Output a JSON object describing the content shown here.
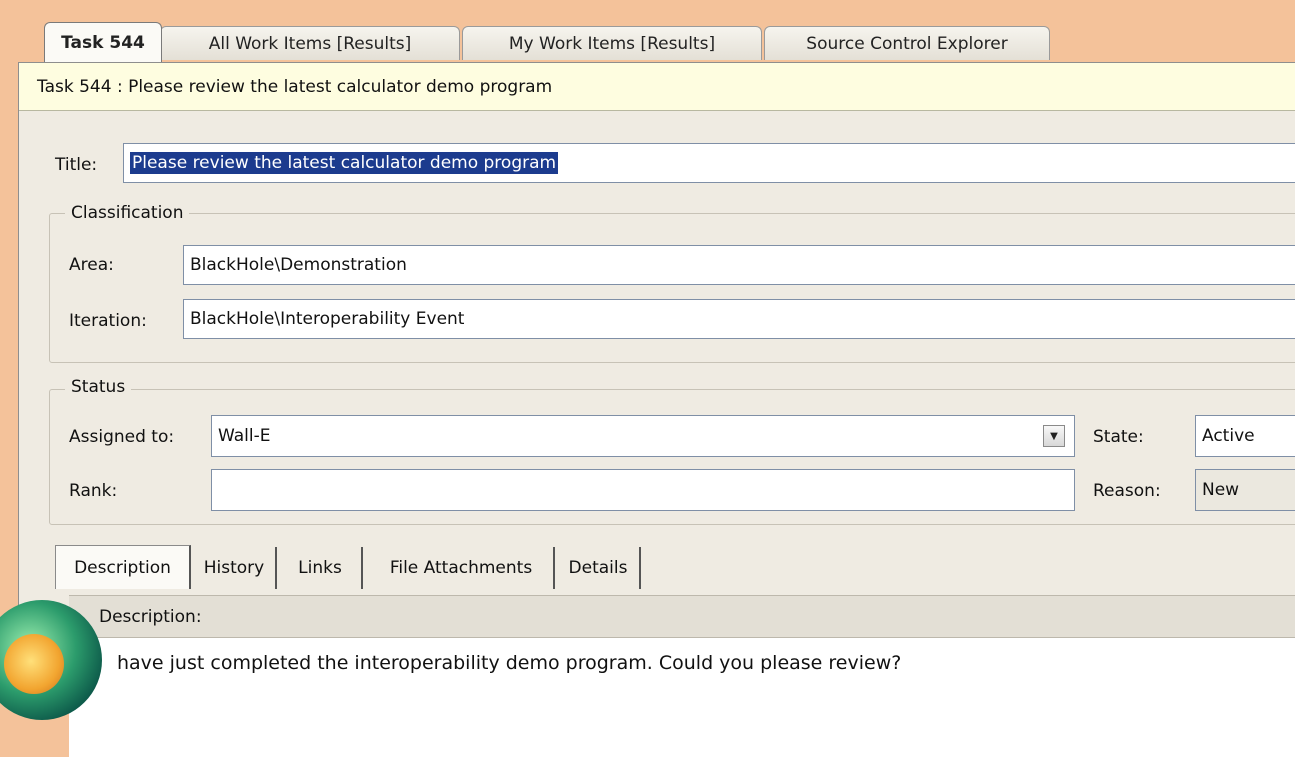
{
  "tabs": [
    {
      "label": "Task 544",
      "active": true
    },
    {
      "label": "All Work Items [Results]",
      "active": false
    },
    {
      "label": "My Work Items [Results]",
      "active": false
    },
    {
      "label": "Source Control Explorer",
      "active": false
    }
  ],
  "header": {
    "text": "Task 544 : Please review the latest calculator demo program"
  },
  "title_field": {
    "label": "Title:",
    "value": "Please review the latest calculator demo program"
  },
  "classification": {
    "legend": "Classification",
    "area_label": "Area:",
    "area_value": "BlackHole\\Demonstration",
    "iteration_label": "Iteration:",
    "iteration_value": "BlackHole\\Interoperability Event"
  },
  "status": {
    "legend": "Status",
    "assigned_label": "Assigned to:",
    "assigned_value": "Wall-E",
    "rank_label": "Rank:",
    "rank_value": "",
    "state_label": "State:",
    "state_value": "Active",
    "reason_label": "Reason:",
    "reason_value": "New"
  },
  "detail_tabs": [
    {
      "label": "Description",
      "active": true
    },
    {
      "label": "History",
      "active": false
    },
    {
      "label": "Links",
      "active": false
    },
    {
      "label": "File Attachments",
      "active": false
    },
    {
      "label": "Details",
      "active": false
    }
  ],
  "description": {
    "header": "Description:",
    "body": "have just completed the interoperability demo program. Could you please review?"
  },
  "colors": {
    "background": "#f4c29a",
    "panel": "#efebe2",
    "header_bar": "#fefde0",
    "selection": "#1c3b8e"
  }
}
